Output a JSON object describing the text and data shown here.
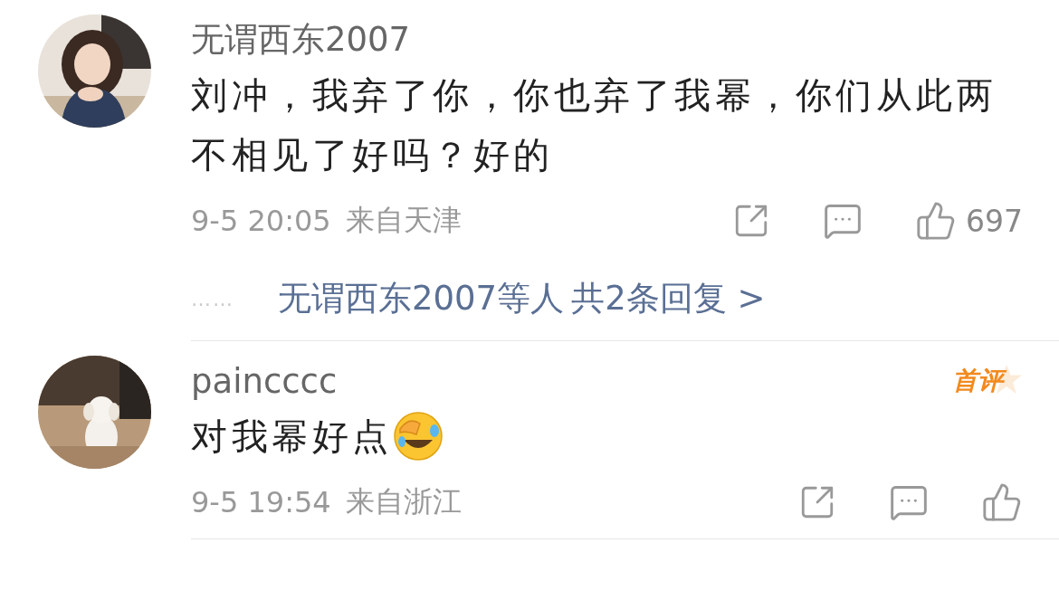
{
  "comments": [
    {
      "user": "无谓西东2007",
      "text": "刘冲，我弃了你，你也弃了我幂，你们从此两不相见了好吗？好的",
      "emoji": false,
      "time": "9-5 20:05",
      "location": "来自天津",
      "likes": "697",
      "replies": {
        "ellipsis": "……",
        "names": "无谓西东2007等人",
        "count": "共2条回复 >"
      }
    },
    {
      "user": "paincccc",
      "badge": "首评",
      "text": "对我幂好点",
      "emoji": true,
      "time": "9-5 19:54",
      "location": "来自浙江"
    }
  ]
}
